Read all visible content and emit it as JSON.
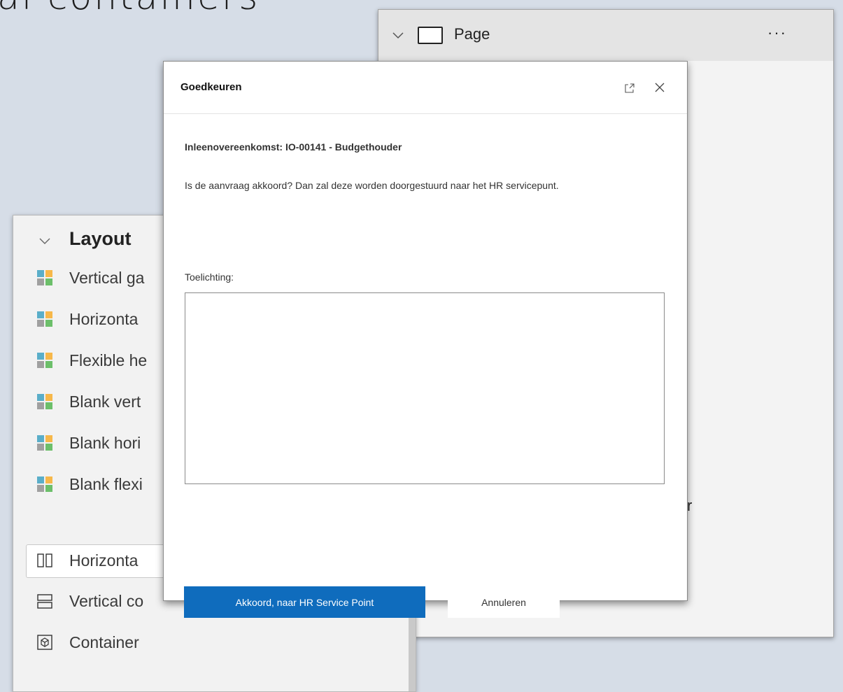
{
  "background": {
    "title_fragment": "al containers"
  },
  "page_panel": {
    "label": "Page",
    "more": "···",
    "tail_text": "r"
  },
  "layout_panel": {
    "title": "Layout",
    "items": [
      {
        "label": "Vertical ga",
        "icon": "gallery-icon"
      },
      {
        "label": "Horizonta",
        "icon": "gallery-icon"
      },
      {
        "label": "Flexible he",
        "icon": "gallery-icon"
      },
      {
        "label": "Blank vert",
        "icon": "gallery-icon"
      },
      {
        "label": "Blank hori",
        "icon": "gallery-icon"
      },
      {
        "label": "Blank flexi",
        "icon": "gallery-icon"
      },
      {
        "label": "Horizonta",
        "icon": "horizontal-container-icon",
        "selected": true
      },
      {
        "label": "Vertical co",
        "icon": "vertical-container-icon"
      },
      {
        "label": "Container",
        "icon": "container-icon"
      }
    ]
  },
  "dialog": {
    "title": "Goedkeuren",
    "subtitle": "Inleenovereenkomst: IO-00141 - Budgethouder",
    "question": "Is de aanvraag akkoord? Dan zal deze worden doorgestuurd naar het HR servicepunt.",
    "comment_label": "Toelichting:",
    "comment_value": "",
    "primary_button": "Akkoord, naar HR Service Point",
    "secondary_button": "Annuleren"
  },
  "colors": {
    "primary": "#0f6cbd",
    "background": "#d6dde7",
    "gallery_orange": "#f7b84a",
    "gallery_teal": "#5aaec9",
    "gallery_green": "#6cbf6a",
    "gallery_gray": "#a0a0a0"
  }
}
